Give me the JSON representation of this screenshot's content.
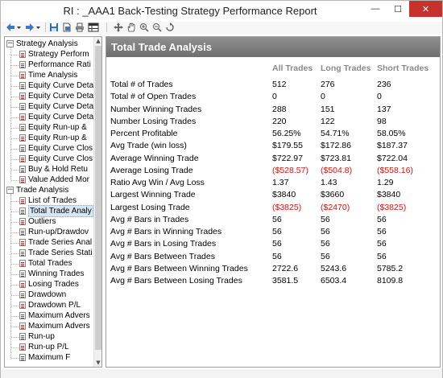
{
  "window": {
    "title": "RI : _AAA1 Back-Testing Strategy Performance Report",
    "minimize_glyph": "—",
    "maximize_glyph": "☐",
    "close_glyph": "✕"
  },
  "toolbar": {
    "icons": [
      "back-icon",
      "back-dropdown-icon",
      "forward-icon",
      "forward-dropdown-icon",
      "save-icon",
      "export-icon",
      "print-icon",
      "table-icon",
      "move-icon",
      "hand-icon",
      "zoom-in-icon",
      "zoom-out-icon",
      "zoom-reset-icon"
    ]
  },
  "tree": {
    "groups": [
      {
        "label": "Strategy Analysis",
        "expander": "−",
        "items": [
          "Strategy Perform",
          "Performance Rati",
          "Time Analysis",
          "Equity Curve Deta",
          "Equity Curve Deta",
          "Equity Curve Deta",
          "Equity Curve Deta",
          "Equity Run-up &",
          "Equity Run-up &",
          "Equity Curve Clos",
          "Equity Curve Clos",
          "Buy & Hold Retu",
          "Value Added Mor"
        ]
      },
      {
        "label": "Trade Analysis",
        "expander": "−",
        "items": [
          "List of Trades",
          "Total Trade Analy",
          "Outliers",
          "Run-up/Drawdov",
          "Trade Series Anal",
          "Trade Series Stati",
          "Total Trades",
          "Winning Trades",
          "Losing Trades",
          "Drawdown",
          "Drawdown P/L",
          "Maximum Advers",
          "Maximum Advers",
          "Run-up",
          "Run-up P/L",
          "Maximum F"
        ]
      }
    ],
    "selected": "Total Trade Analy",
    "scroll_up": "▲",
    "scroll_down": "▼"
  },
  "panel": {
    "title": "Total Trade Analysis",
    "columns": [
      "All Trades",
      "Long Trades",
      "Short Trades"
    ],
    "rows": [
      {
        "label": "Total # of Trades",
        "all": "512",
        "long": "276",
        "short": "236",
        "neg": false
      },
      {
        "label": "Total # of Open Trades",
        "all": "0",
        "long": "0",
        "short": "0",
        "neg": false
      },
      {
        "label": "Number Winning Trades",
        "all": "288",
        "long": "151",
        "short": "137",
        "neg": false
      },
      {
        "label": "Number Losing Trades",
        "all": "220",
        "long": "122",
        "short": "98",
        "neg": false
      },
      {
        "label": "Percent Profitable",
        "all": "56.25%",
        "long": "54.71%",
        "short": "58.05%",
        "neg": false
      },
      {
        "label": "Avg Trade (win  loss)",
        "all": "$179.55",
        "long": "$172.86",
        "short": "$187.37",
        "neg": false
      },
      {
        "label": "Average Winning Trade",
        "all": "$722.97",
        "long": "$723.81",
        "short": "$722.04",
        "neg": false
      },
      {
        "label": "Average Losing Trade",
        "all": "($528.57)",
        "long": "($504.8)",
        "short": "($558.16)",
        "neg": true
      },
      {
        "label": "Ratio Avg Win / Avg Loss",
        "all": "1.37",
        "long": "1.43",
        "short": "1.29",
        "neg": false
      },
      {
        "label": "Largest Winning Trade",
        "all": "$3840",
        "long": "$3660",
        "short": "$3840",
        "neg": false
      },
      {
        "label": "Largest Losing Trade",
        "all": "($3825)",
        "long": "($2470)",
        "short": "($3825)",
        "neg": true
      },
      {
        "label": "Avg # Bars in Trades",
        "all": "56",
        "long": "56",
        "short": "56",
        "neg": false
      },
      {
        "label": "Avg # Bars in Winning Trades",
        "all": "56",
        "long": "56",
        "short": "56",
        "neg": false
      },
      {
        "label": "Avg # Bars in Losing Trades",
        "all": "56",
        "long": "56",
        "short": "56",
        "neg": false
      },
      {
        "label": "Avg # Bars Between Trades",
        "all": "56",
        "long": "56",
        "short": "56",
        "neg": false
      },
      {
        "label": "Avg # Bars Between Winning Trades",
        "all": "2722.6",
        "long": "5243.6",
        "short": "5785.2",
        "neg": false
      },
      {
        "label": "Avg # Bars Between Losing Trades",
        "all": "3581.5",
        "long": "6503.4",
        "short": "8109.8",
        "neg": false
      }
    ]
  },
  "colors": {
    "header_bg": "#7f7f7f",
    "negative": "#e01010",
    "column_header": "#8a8a8a",
    "close_button": "#c7312b"
  }
}
